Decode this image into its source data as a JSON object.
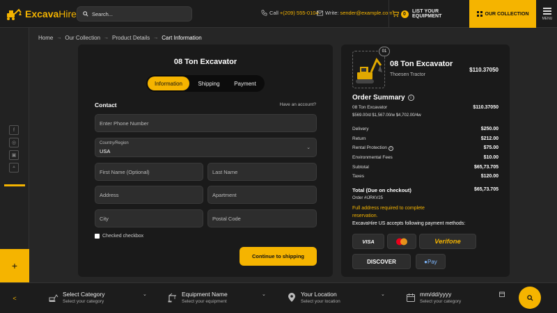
{
  "header": {
    "logo_main": "Excava",
    "logo_sub": "Hire",
    "search_placeholder": "Search...",
    "call_label": "Call",
    "phone": "+(209) 555-0104",
    "write_label": "Write:",
    "email": "sender@example.com",
    "cart_count": "0",
    "list_equipment": "LIST YOUR EQUIPMENT",
    "our_collection": "OUR COLLECTION",
    "menu_label": "MENU"
  },
  "breadcrumb": {
    "items": [
      "Home",
      "Our Collection",
      "Product Details",
      "Cart Information"
    ],
    "separator": "→"
  },
  "form": {
    "title": "08 Ton Excavator",
    "tabs": [
      "Information",
      "Shipping",
      "Payment"
    ],
    "active_tab": "Information",
    "contact_heading": "Contact",
    "have_account": "Have an account?",
    "phone_placeholder": "Enter Phone Number",
    "country_label": "Country/Region",
    "country_value": "USA",
    "first_name_placeholder": "First Name (Optional)",
    "last_name_placeholder": "Last Name",
    "address_placeholder": "Address",
    "apartment_placeholder": "Apartment",
    "city_placeholder": "City",
    "postal_placeholder": "Postal Code",
    "checkbox_label": "Checked checkbox",
    "continue_button": "Continue to shipping"
  },
  "summary": {
    "badge": "01",
    "product_name": "08 Ton Excavator",
    "brand": "Thoesen Tractor",
    "product_price": "$110.37050",
    "title": "Order Summary",
    "item_name": "08 Ton Excavator",
    "item_price": "$110.37050",
    "item_rates": "$569.00/d $1,567.00/w $4,702.00/4w",
    "lines": [
      {
        "label": "Delivery",
        "value": "$250.00",
        "info": false
      },
      {
        "label": "Return",
        "value": "$212.00",
        "info": false
      },
      {
        "label": "Rental Protection",
        "value": "$75.00",
        "info": true
      },
      {
        "label": "Environmental Fees",
        "value": "$10.00",
        "info": false
      },
      {
        "label": "Subtotal",
        "value": "$65,73.705",
        "info": false
      },
      {
        "label": "Taxes",
        "value": "$120.00",
        "info": false
      }
    ],
    "total_label": "Total (Due on checkout)",
    "total_value": "$65,73.705",
    "order_id": "Order #IJRKV25",
    "note": "Full address required to complete reservation.",
    "payment_heading": "ExcavaHire US accepts following payment methods:",
    "payment_methods": {
      "visa": "VISA",
      "verifone": "Verifone",
      "discover": "DISCOVER",
      "apple_pay": "Pay"
    }
  },
  "bottom_bar": {
    "category_title": "Select Category",
    "category_sub": "Select your category",
    "equipment_title": "Equipment Name",
    "equipment_sub": "Select your equipment",
    "location_title": "Your Location",
    "location_sub": "Select your location",
    "date_title": "mm/dd/yyyy",
    "date_sub": "Select your category"
  },
  "colors": {
    "accent": "#f5b400",
    "panel": "#1a1a1a",
    "background": "#262626"
  }
}
